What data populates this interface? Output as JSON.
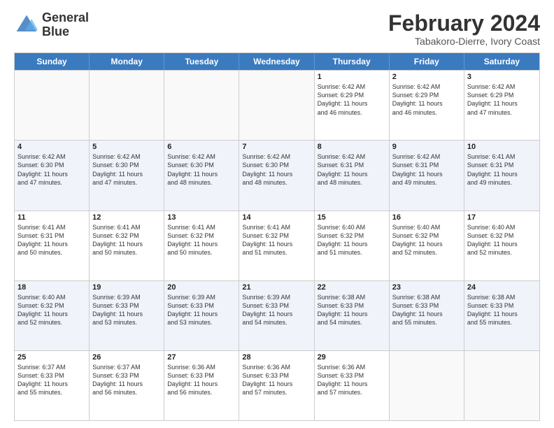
{
  "header": {
    "logo_line1": "General",
    "logo_line2": "Blue",
    "main_title": "February 2024",
    "subtitle": "Tabakoro-Dierre, Ivory Coast"
  },
  "calendar": {
    "days_of_week": [
      "Sunday",
      "Monday",
      "Tuesday",
      "Wednesday",
      "Thursday",
      "Friday",
      "Saturday"
    ],
    "rows": [
      {
        "alt": false,
        "cells": [
          {
            "day": "",
            "info": ""
          },
          {
            "day": "",
            "info": ""
          },
          {
            "day": "",
            "info": ""
          },
          {
            "day": "",
            "info": ""
          },
          {
            "day": "1",
            "info": "Sunrise: 6:42 AM\nSunset: 6:29 PM\nDaylight: 11 hours\nand 46 minutes."
          },
          {
            "day": "2",
            "info": "Sunrise: 6:42 AM\nSunset: 6:29 PM\nDaylight: 11 hours\nand 46 minutes."
          },
          {
            "day": "3",
            "info": "Sunrise: 6:42 AM\nSunset: 6:29 PM\nDaylight: 11 hours\nand 47 minutes."
          }
        ]
      },
      {
        "alt": true,
        "cells": [
          {
            "day": "4",
            "info": "Sunrise: 6:42 AM\nSunset: 6:30 PM\nDaylight: 11 hours\nand 47 minutes."
          },
          {
            "day": "5",
            "info": "Sunrise: 6:42 AM\nSunset: 6:30 PM\nDaylight: 11 hours\nand 47 minutes."
          },
          {
            "day": "6",
            "info": "Sunrise: 6:42 AM\nSunset: 6:30 PM\nDaylight: 11 hours\nand 48 minutes."
          },
          {
            "day": "7",
            "info": "Sunrise: 6:42 AM\nSunset: 6:30 PM\nDaylight: 11 hours\nand 48 minutes."
          },
          {
            "day": "8",
            "info": "Sunrise: 6:42 AM\nSunset: 6:31 PM\nDaylight: 11 hours\nand 48 minutes."
          },
          {
            "day": "9",
            "info": "Sunrise: 6:42 AM\nSunset: 6:31 PM\nDaylight: 11 hours\nand 49 minutes."
          },
          {
            "day": "10",
            "info": "Sunrise: 6:41 AM\nSunset: 6:31 PM\nDaylight: 11 hours\nand 49 minutes."
          }
        ]
      },
      {
        "alt": false,
        "cells": [
          {
            "day": "11",
            "info": "Sunrise: 6:41 AM\nSunset: 6:31 PM\nDaylight: 11 hours\nand 50 minutes."
          },
          {
            "day": "12",
            "info": "Sunrise: 6:41 AM\nSunset: 6:32 PM\nDaylight: 11 hours\nand 50 minutes."
          },
          {
            "day": "13",
            "info": "Sunrise: 6:41 AM\nSunset: 6:32 PM\nDaylight: 11 hours\nand 50 minutes."
          },
          {
            "day": "14",
            "info": "Sunrise: 6:41 AM\nSunset: 6:32 PM\nDaylight: 11 hours\nand 51 minutes."
          },
          {
            "day": "15",
            "info": "Sunrise: 6:40 AM\nSunset: 6:32 PM\nDaylight: 11 hours\nand 51 minutes."
          },
          {
            "day": "16",
            "info": "Sunrise: 6:40 AM\nSunset: 6:32 PM\nDaylight: 11 hours\nand 52 minutes."
          },
          {
            "day": "17",
            "info": "Sunrise: 6:40 AM\nSunset: 6:32 PM\nDaylight: 11 hours\nand 52 minutes."
          }
        ]
      },
      {
        "alt": true,
        "cells": [
          {
            "day": "18",
            "info": "Sunrise: 6:40 AM\nSunset: 6:32 PM\nDaylight: 11 hours\nand 52 minutes."
          },
          {
            "day": "19",
            "info": "Sunrise: 6:39 AM\nSunset: 6:33 PM\nDaylight: 11 hours\nand 53 minutes."
          },
          {
            "day": "20",
            "info": "Sunrise: 6:39 AM\nSunset: 6:33 PM\nDaylight: 11 hours\nand 53 minutes."
          },
          {
            "day": "21",
            "info": "Sunrise: 6:39 AM\nSunset: 6:33 PM\nDaylight: 11 hours\nand 54 minutes."
          },
          {
            "day": "22",
            "info": "Sunrise: 6:38 AM\nSunset: 6:33 PM\nDaylight: 11 hours\nand 54 minutes."
          },
          {
            "day": "23",
            "info": "Sunrise: 6:38 AM\nSunset: 6:33 PM\nDaylight: 11 hours\nand 55 minutes."
          },
          {
            "day": "24",
            "info": "Sunrise: 6:38 AM\nSunset: 6:33 PM\nDaylight: 11 hours\nand 55 minutes."
          }
        ]
      },
      {
        "alt": false,
        "cells": [
          {
            "day": "25",
            "info": "Sunrise: 6:37 AM\nSunset: 6:33 PM\nDaylight: 11 hours\nand 55 minutes."
          },
          {
            "day": "26",
            "info": "Sunrise: 6:37 AM\nSunset: 6:33 PM\nDaylight: 11 hours\nand 56 minutes."
          },
          {
            "day": "27",
            "info": "Sunrise: 6:36 AM\nSunset: 6:33 PM\nDaylight: 11 hours\nand 56 minutes."
          },
          {
            "day": "28",
            "info": "Sunrise: 6:36 AM\nSunset: 6:33 PM\nDaylight: 11 hours\nand 57 minutes."
          },
          {
            "day": "29",
            "info": "Sunrise: 6:36 AM\nSunset: 6:33 PM\nDaylight: 11 hours\nand 57 minutes."
          },
          {
            "day": "",
            "info": ""
          },
          {
            "day": "",
            "info": ""
          }
        ]
      }
    ]
  }
}
